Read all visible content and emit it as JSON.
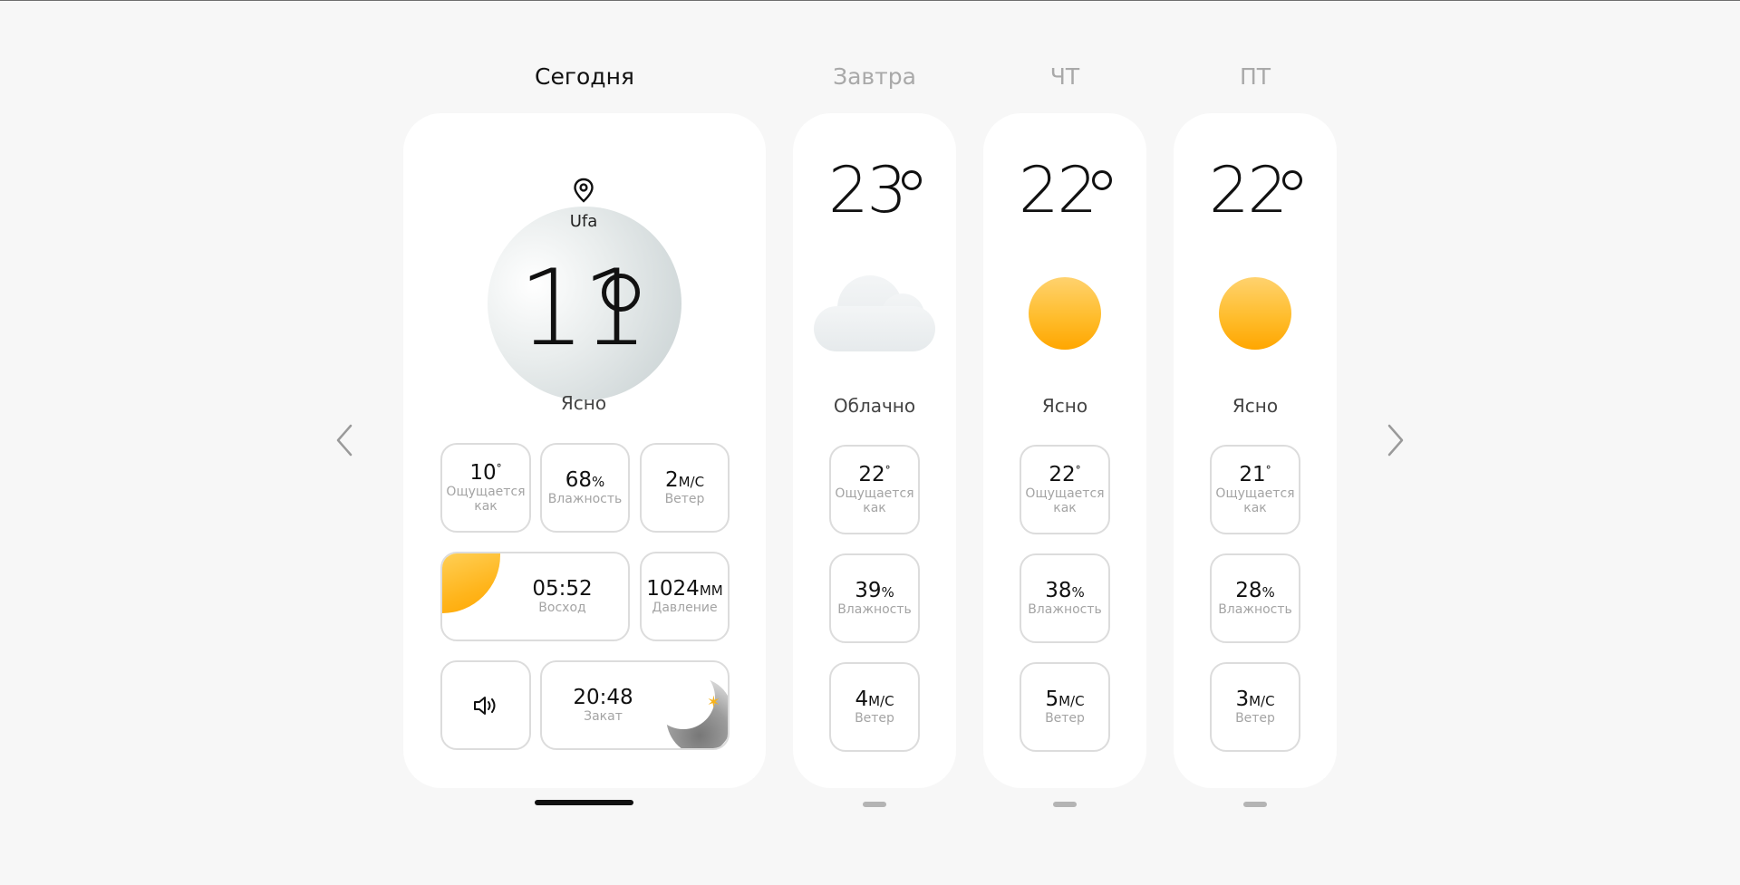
{
  "today": {
    "heading": "Сегодня",
    "city": "Ufa",
    "temperature": "11",
    "condition": "Ясно",
    "feels_like": {
      "value": "10",
      "unit": "°",
      "label": "Ощущается как"
    },
    "humidity": {
      "value": "68",
      "unit": "%",
      "label": "Влажность"
    },
    "wind": {
      "value": "2",
      "unit": "М/С",
      "label": "Ветер"
    },
    "sunrise": {
      "time": "05:52",
      "label": "Восход"
    },
    "pressure": {
      "value": "1024",
      "unit": "ММ",
      "label": "Давление"
    },
    "sunset": {
      "time": "20:48",
      "label": "Закат"
    },
    "icons": [
      "location-pin-icon",
      "speaker-icon",
      "sun-icon",
      "moon-icon",
      "star-icon"
    ]
  },
  "forecast": [
    {
      "heading": "Завтра",
      "temperature": "23",
      "condition": "Облачно",
      "icon": "cloud-icon",
      "feels_like": {
        "value": "22",
        "unit": "°",
        "label": "Ощущается как"
      },
      "humidity": {
        "value": "39",
        "unit": "%",
        "label": "Влажность"
      },
      "wind": {
        "value": "4",
        "unit": "М/С",
        "label": "Ветер"
      }
    },
    {
      "heading": "ЧТ",
      "temperature": "22",
      "condition": "Ясно",
      "icon": "sun-icon",
      "feels_like": {
        "value": "22",
        "unit": "°",
        "label": "Ощущается как"
      },
      "humidity": {
        "value": "38",
        "unit": "%",
        "label": "Влажность"
      },
      "wind": {
        "value": "5",
        "unit": "М/С",
        "label": "Ветер"
      }
    },
    {
      "heading": "ПТ",
      "temperature": "22",
      "condition": "Ясно",
      "icon": "sun-icon",
      "feels_like": {
        "value": "21",
        "unit": "°",
        "label": "Ощущается как"
      },
      "humidity": {
        "value": "28",
        "unit": "%",
        "label": "Влажность"
      },
      "wind": {
        "value": "3",
        "unit": "М/С",
        "label": "Ветер"
      }
    }
  ],
  "navigation": {
    "prev_icon": "chevron-left-icon",
    "next_icon": "chevron-right-icon"
  },
  "colors": {
    "sun": "#ffb51c",
    "background": "#f7f7f7",
    "card": "#ffffff",
    "tile_border": "#dcdcdc",
    "muted_text": "#a4a4a4",
    "star": "#f6b21b"
  }
}
